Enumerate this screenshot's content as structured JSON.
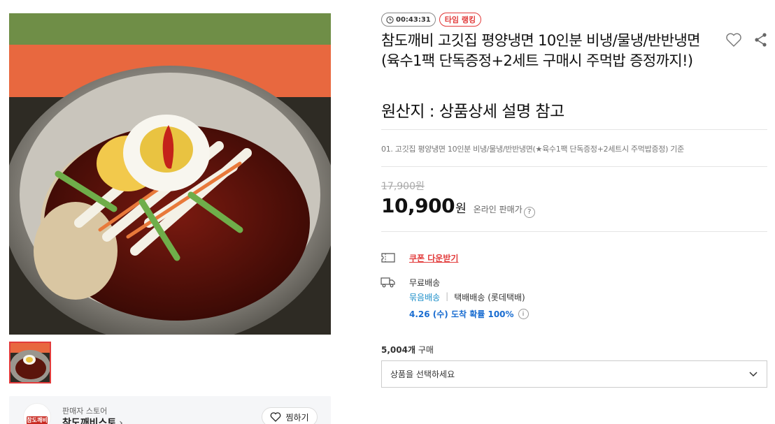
{
  "product": {
    "timer": "00:43:31",
    "rank_badge": "타임 랭킹",
    "title": "참도깨비 고깃집 평양냉면 10인분 비냉/물냉/반반냉면 (육수1팩 단독증정+2세트 구매시 주먹밥 증정까지!)",
    "origin": "원산지 : 상품상세 설명 참고",
    "option_desc": "01. 고깃집 평양냉면 10인분 비냉/물냉/반반냉면(★육수1팩 단독증정+2세트시 주먹밥증정) 기준",
    "original_price": "17,900원",
    "price": "10,900",
    "price_unit": "원",
    "online_price_label": "온라인 판매가",
    "help_glyph": "?"
  },
  "benefits": {
    "coupon_label": "쿠폰 다운받기",
    "shipping_free": "무료배송",
    "bundle_label": "묶음배송",
    "separator": "|",
    "courier": "택배배송 (롯데택배)",
    "arrival": "4.26 (수) 도착 확률 100%",
    "info_glyph": "i"
  },
  "purchase": {
    "count": "5,004개",
    "label": "구매",
    "select_placeholder": "상품을 선택하세요"
  },
  "seller": {
    "label": "판매자 스토어",
    "name": "참도깨비스토",
    "logo_text": "참도깨비",
    "favorite_label": "찜하기"
  },
  "icons": {
    "heart": "heart-icon",
    "share": "share-icon",
    "clock": "clock-icon",
    "coupon": "coupon-icon",
    "truck": "truck-icon",
    "chevron": "chevron-down-icon"
  },
  "colors": {
    "accent_red": "#e23b3b",
    "link_blue": "#1a6dd1",
    "bundle_blue": "#1d8fc9"
  }
}
